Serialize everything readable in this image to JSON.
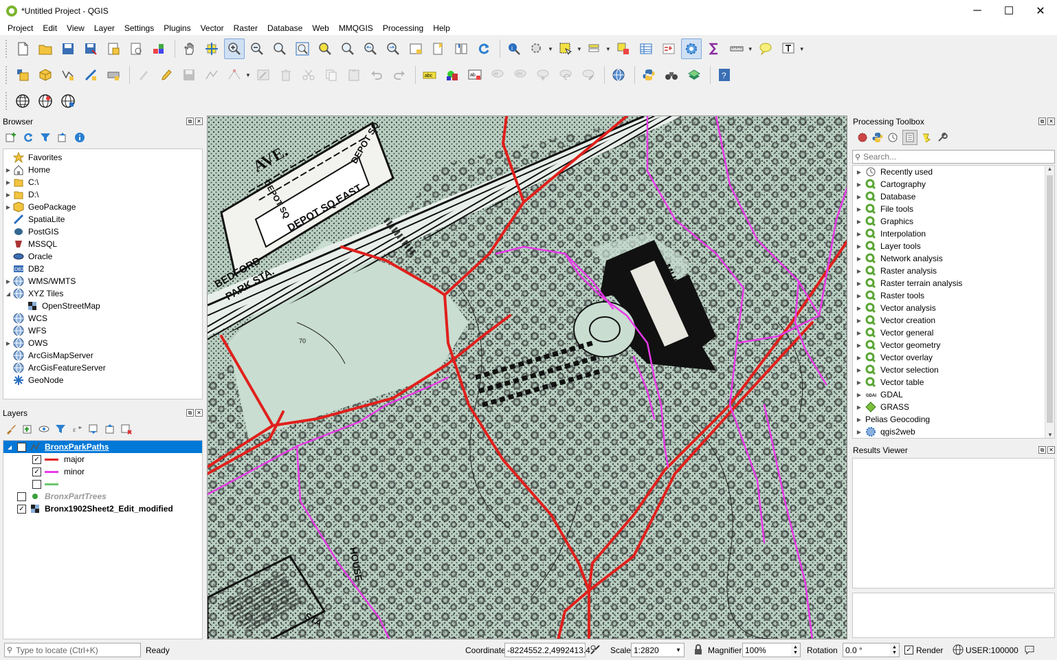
{
  "window": {
    "title": "*Untitled Project - QGIS",
    "minimize": "─",
    "maximize": "☐",
    "close": "✕"
  },
  "menu": [
    "Project",
    "Edit",
    "View",
    "Layer",
    "Settings",
    "Plugins",
    "Vector",
    "Raster",
    "Database",
    "Web",
    "MMQGIS",
    "Processing",
    "Help"
  ],
  "browser": {
    "title": "Browser",
    "items": [
      {
        "label": "Favorites",
        "icon": "star-icon",
        "arrow": ""
      },
      {
        "label": "Home",
        "icon": "home-icon",
        "arrow": "▶"
      },
      {
        "label": "C:\\",
        "icon": "drive-icon",
        "arrow": "▶"
      },
      {
        "label": "D:\\",
        "icon": "drive-icon",
        "arrow": "▶"
      },
      {
        "label": "GeoPackage",
        "icon": "geopackage-icon",
        "arrow": "▶"
      },
      {
        "label": "SpatiaLite",
        "icon": "spatialite-icon",
        "arrow": ""
      },
      {
        "label": "PostGIS",
        "icon": "postgis-icon",
        "arrow": ""
      },
      {
        "label": "MSSQL",
        "icon": "mssql-icon",
        "arrow": ""
      },
      {
        "label": "Oracle",
        "icon": "oracle-icon",
        "arrow": ""
      },
      {
        "label": "DB2",
        "icon": "db2-icon",
        "arrow": ""
      },
      {
        "label": "WMS/WMTS",
        "icon": "globe-icon",
        "arrow": "▶"
      },
      {
        "label": "XYZ Tiles",
        "icon": "globe-icon",
        "arrow": "◢"
      },
      {
        "label": "OpenStreetMap",
        "icon": "tiles-icon",
        "arrow": "",
        "indent": true
      },
      {
        "label": "WCS",
        "icon": "globe-icon",
        "arrow": ""
      },
      {
        "label": "WFS",
        "icon": "globe-icon",
        "arrow": ""
      },
      {
        "label": "OWS",
        "icon": "globe-icon",
        "arrow": "▶"
      },
      {
        "label": "ArcGisMapServer",
        "icon": "globe-icon",
        "arrow": ""
      },
      {
        "label": "ArcGisFeatureServer",
        "icon": "globe-icon",
        "arrow": ""
      },
      {
        "label": "GeoNode",
        "icon": "geonode-icon",
        "arrow": ""
      }
    ]
  },
  "layers": {
    "title": "Layers",
    "rows": [
      {
        "label": "BronxParkPaths",
        "checked": true,
        "type": "line-layer",
        "selected": true
      },
      {
        "label": "major",
        "checked": true,
        "type": "legend",
        "color": "#e0201c"
      },
      {
        "label": "minor",
        "checked": true,
        "type": "legend",
        "color": "#e83ae8"
      },
      {
        "label": "",
        "checked": false,
        "type": "legend",
        "color": "#6dc76d"
      },
      {
        "label": "BronxPartTrees",
        "checked": false,
        "type": "point-layer"
      },
      {
        "label": "Bronx1902Sheet2_Edit_modified",
        "checked": true,
        "type": "raster-layer"
      }
    ]
  },
  "toolbox": {
    "title": "Processing Toolbox",
    "search_placeholder": "Search...",
    "items": [
      {
        "label": "Recently used",
        "icon": "clock-icon"
      },
      {
        "label": "Cartography",
        "icon": "qgis-icon"
      },
      {
        "label": "Database",
        "icon": "qgis-icon"
      },
      {
        "label": "File tools",
        "icon": "qgis-icon"
      },
      {
        "label": "Graphics",
        "icon": "qgis-icon"
      },
      {
        "label": "Interpolation",
        "icon": "qgis-icon"
      },
      {
        "label": "Layer tools",
        "icon": "qgis-icon"
      },
      {
        "label": "Network analysis",
        "icon": "qgis-icon"
      },
      {
        "label": "Raster analysis",
        "icon": "qgis-icon"
      },
      {
        "label": "Raster terrain analysis",
        "icon": "qgis-icon"
      },
      {
        "label": "Raster tools",
        "icon": "qgis-icon"
      },
      {
        "label": "Vector analysis",
        "icon": "qgis-icon"
      },
      {
        "label": "Vector creation",
        "icon": "qgis-icon"
      },
      {
        "label": "Vector general",
        "icon": "qgis-icon"
      },
      {
        "label": "Vector geometry",
        "icon": "qgis-icon"
      },
      {
        "label": "Vector overlay",
        "icon": "qgis-icon"
      },
      {
        "label": "Vector selection",
        "icon": "qgis-icon"
      },
      {
        "label": "Vector table",
        "icon": "qgis-icon"
      },
      {
        "label": "GDAL",
        "icon": "gdal-icon"
      },
      {
        "label": "GRASS",
        "icon": "grass-icon"
      },
      {
        "label": "Pelias Geocoding",
        "icon": "",
        "noicon": true
      },
      {
        "label": "qgis2web",
        "icon": "gear-icon"
      }
    ]
  },
  "results": {
    "title": "Results Viewer"
  },
  "map": {
    "labels": {
      "ave": "AVE.",
      "depot_sq_east": "DEPOT SQ.EAST",
      "depot_sq": "DEPOT SQ",
      "depot_so": "DEPOT SQ",
      "bedford": "BEDFORD",
      "park_sta": "PARK STA.",
      "museum": "MUSEUM",
      "house": "HOUSE",
      "sta": "STA",
      "contour": "70"
    },
    "colors": {
      "major": "#e0201c",
      "minor": "#e83ae8",
      "paper": "#b9cfc2"
    }
  },
  "status": {
    "locate_placeholder": "Type to locate (Ctrl+K)",
    "ready": "Ready",
    "coordinate_label": "Coordinate",
    "coordinate_value": "-8224552.2,4992413.4",
    "scale_label": "Scale",
    "scale_value": "1:2820",
    "magnifier_label": "Magnifier",
    "magnifier_value": "100%",
    "rotation_label": "Rotation",
    "rotation_value": "0.0 °",
    "render_label": "Render",
    "crs": "USER:100000"
  }
}
